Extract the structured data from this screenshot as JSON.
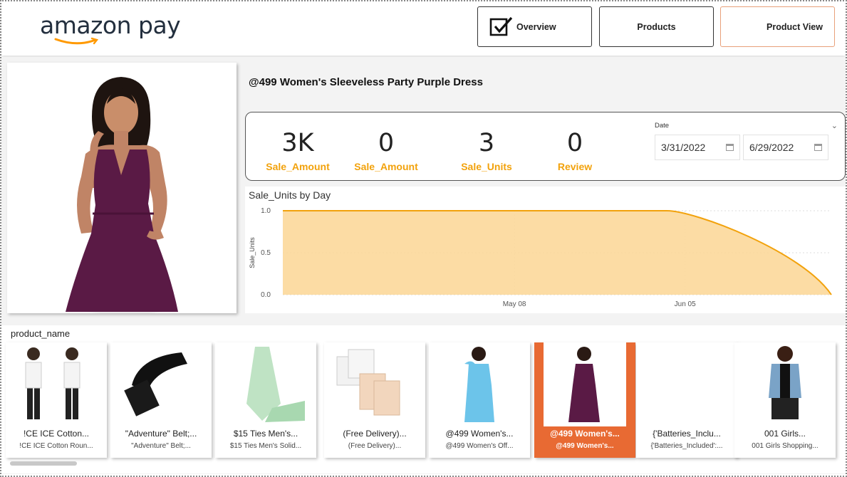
{
  "header": {
    "logo_text": "amazon pay",
    "nav": {
      "overview": "Overview",
      "products": "Products",
      "product_view": "Product View"
    }
  },
  "product": {
    "title": "@499 Women's Sleeveless Party Purple Dress"
  },
  "kpis": [
    {
      "value": "3K",
      "label": "Sale_Amount"
    },
    {
      "value": "0",
      "label": "Sale_Amount"
    },
    {
      "value": "3",
      "label": "Sale_Units"
    },
    {
      "value": "0",
      "label": "Review"
    }
  ],
  "date_filter": {
    "title": "Date",
    "start": "3/31/2022",
    "end": "6/29/2022"
  },
  "chart_data": {
    "type": "area",
    "title": "Sale_Units by Day",
    "xlabel": "",
    "ylabel": "Sale_Units",
    "x": [
      "3/31/2022",
      "6/02/2022",
      "6/29/2022"
    ],
    "series": [
      {
        "values": [
          1.0,
          1.0,
          0.0
        ]
      }
    ],
    "xticks": [
      "May 08",
      "Jun 05"
    ],
    "yticks": [
      "0.0",
      "0.5",
      "1.0"
    ],
    "ylim": [
      0,
      1
    ],
    "grid": true,
    "colors": {
      "line": "#f2a20c",
      "fill": "#fcd89a"
    }
  },
  "slicer": {
    "title": "product_name",
    "items": [
      {
        "name": "!CE ICE Cotton...",
        "sub": "!CE ICE Cotton Roun...",
        "selected": false
      },
      {
        "name": "\"Adventure\" Belt;...",
        "sub": "\"Adventure\" Belt;...",
        "selected": false
      },
      {
        "name": "$15 Ties Men's...",
        "sub": "$15 Ties Men's Solid...",
        "selected": false
      },
      {
        "name": "(Free Delivery)...",
        "sub": "(Free Delivery)...",
        "selected": false
      },
      {
        "name": "@499 Women's...",
        "sub": "@499 Women's Off...",
        "selected": false
      },
      {
        "name": "@499 Women's...",
        "sub": "@499 Women's...",
        "selected": true
      },
      {
        "name": "{'Batteries_Inclu...",
        "sub": "{'Batteries_Included':...",
        "selected": false
      },
      {
        "name": "001 Girls...",
        "sub": "001 Girls Shopping...",
        "selected": false
      }
    ]
  },
  "colors": {
    "accent": "#f2a20c",
    "selected_tile": "#e86a33",
    "dress_purple": "#5a1a45"
  }
}
